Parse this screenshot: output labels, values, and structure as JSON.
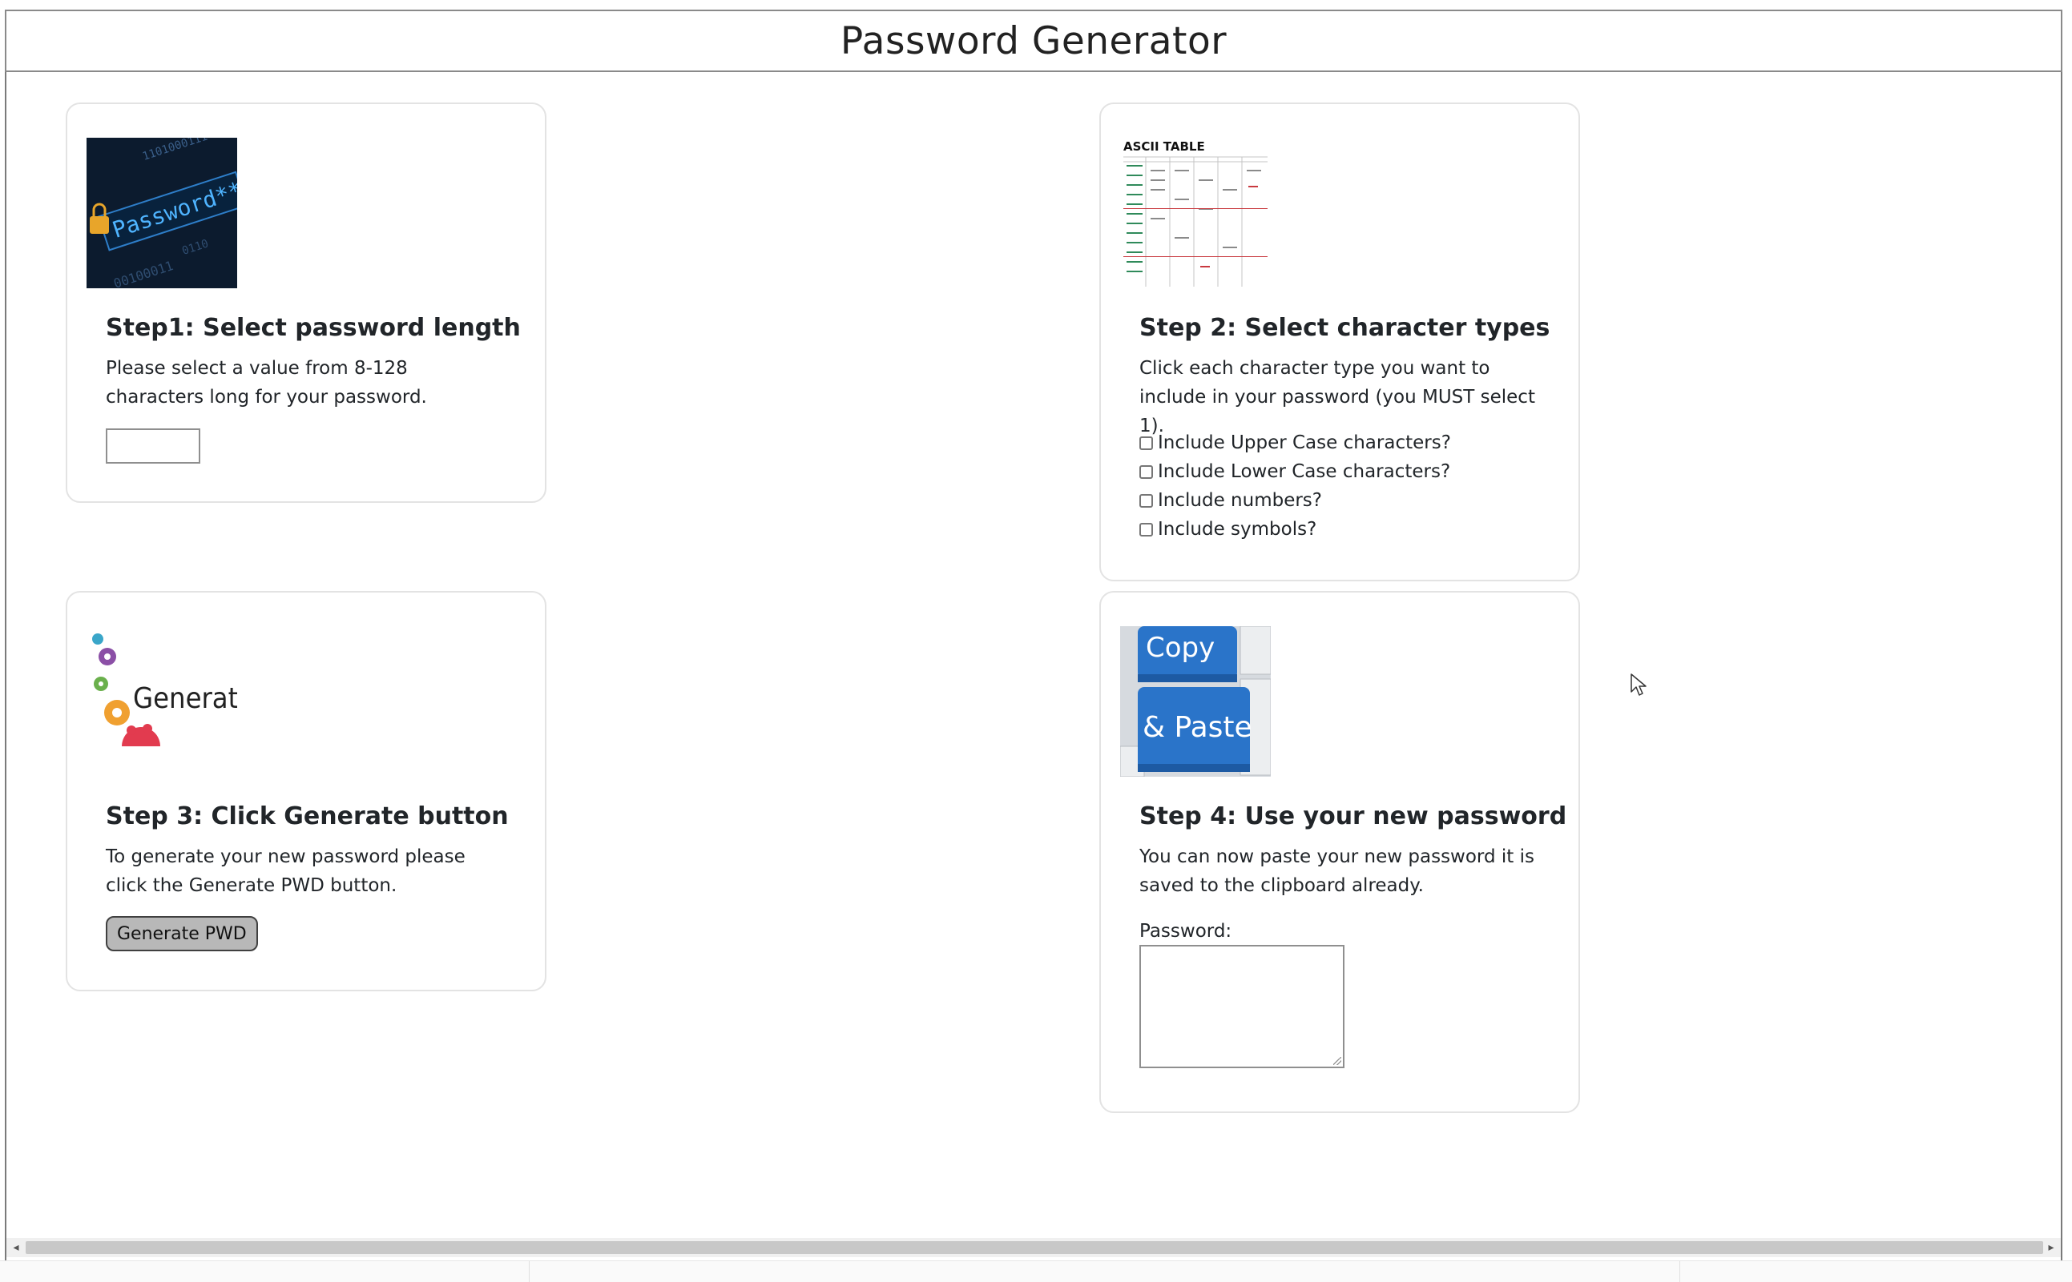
{
  "header": {
    "title": "Password Generator"
  },
  "step1": {
    "heading": "Step1: Select password length",
    "text": "Please select a value from 8-128 characters long for your password.",
    "length_value": ""
  },
  "step2": {
    "heading": "Step 2: Select character types",
    "text": "Click each character type you want to include in your password (you MUST select 1).",
    "image_title": "ASCII TABLE",
    "options": [
      {
        "label": "Include Upper Case characters?",
        "checked": false
      },
      {
        "label": "Include Lower Case characters?",
        "checked": false
      },
      {
        "label": "Include numbers?",
        "checked": false
      },
      {
        "label": "Include symbols?",
        "checked": false
      }
    ]
  },
  "step3": {
    "heading": "Step 3: Click Generate button",
    "text": "To generate your new password please click the Generate PWD button.",
    "image_text": "Generate",
    "button_label": "Generate PWD"
  },
  "step4": {
    "heading": "Step 4: Use your new password",
    "text": "You can now paste your new password it is saved to the clipboard already.",
    "image_text_1": "Copy",
    "image_text_2": "& Paste",
    "password_label": "Password:",
    "password_value": ""
  },
  "icons": {
    "step1_image": "password-lock-icon",
    "step2_image": "ascii-table-icon",
    "step3_image": "gears-icon",
    "step4_image": "copy-paste-keys-icon",
    "cursor": "mouse-pointer-icon"
  },
  "colors": {
    "key_blue": "#2a74c9",
    "button_gray": "#b8b8b8",
    "card_border": "#e3e3e3"
  }
}
